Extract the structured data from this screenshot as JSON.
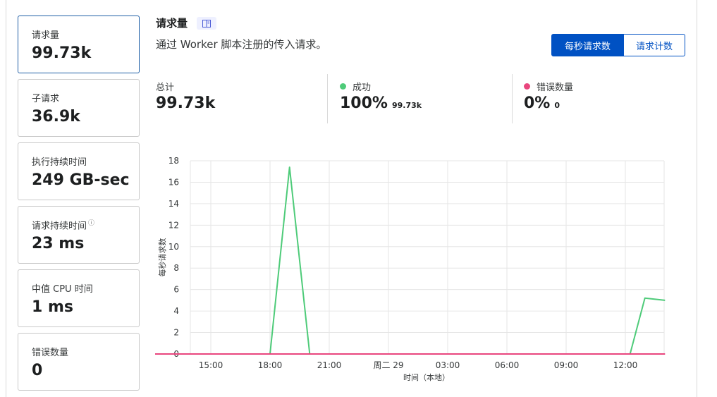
{
  "metrics": [
    {
      "label": "请求量",
      "value": "99.73k",
      "active": true
    },
    {
      "label": "子请求",
      "value": "36.9k"
    },
    {
      "label": "执行持续时间",
      "value": "249 GB-sec"
    },
    {
      "label": "请求持续时间",
      "value": "23 ms",
      "info_icon": "info-icon"
    },
    {
      "label": "中值 CPU 时间",
      "value": "1 ms"
    },
    {
      "label": "错误数量",
      "value": "0"
    }
  ],
  "header": {
    "title": "请求量",
    "doc_icon": "book-icon",
    "subtitle": "通过 Worker 脚本注册的传入请求。"
  },
  "toggle": {
    "rate_label": "每秒请求数",
    "count_label": "请求计数",
    "selected": "rate"
  },
  "stats": {
    "total": {
      "label": "总计",
      "value": "99.73k"
    },
    "success": {
      "label": "成功",
      "value": "100%",
      "sub": "99.73k",
      "color": "#4ecb79"
    },
    "errors": {
      "label": "错误数量",
      "value": "0%",
      "sub": "0",
      "color": "#e9467e"
    }
  },
  "colors": {
    "accent": "#0051c3",
    "success": "#4ecb79",
    "error": "#e9467e",
    "active_border": "#1f5fa6"
  },
  "chart_data": {
    "type": "line",
    "xlabel": "时间（本地）",
    "ylabel": "每秒请求数",
    "ylim": [
      0,
      18
    ],
    "yticks": [
      "0",
      "2",
      "4",
      "6",
      "8",
      "10",
      "12",
      "14",
      "16",
      "18"
    ],
    "xlim": [
      14,
      22
    ],
    "xticks": [
      {
        "x": 15,
        "label": "15:00"
      },
      {
        "x": 16,
        "label": "18:00"
      },
      {
        "x": 17,
        "label": "21:00"
      },
      {
        "x": 18,
        "label": "周二 29"
      },
      {
        "x": 19,
        "label": "03:00"
      },
      {
        "x": 20,
        "label": "06:00"
      },
      {
        "x": 21,
        "label": "09:00"
      },
      {
        "x": 22,
        "label": "12:00"
      }
    ],
    "grid": true,
    "series": [
      {
        "name": "成功",
        "color": "#4ecb79",
        "points": [
          [
            14,
            0
          ],
          [
            16,
            0
          ],
          [
            16.33,
            17.4
          ],
          [
            16.67,
            0
          ],
          [
            21.8,
            0
          ],
          [
            22.08,
            0
          ],
          [
            22.33,
            5.2
          ],
          [
            22.67,
            5.0
          ]
        ]
      },
      {
        "name": "错误数量",
        "color": "#e9467e",
        "points": [
          [
            14,
            0
          ],
          [
            22.67,
            0
          ]
        ]
      }
    ]
  }
}
